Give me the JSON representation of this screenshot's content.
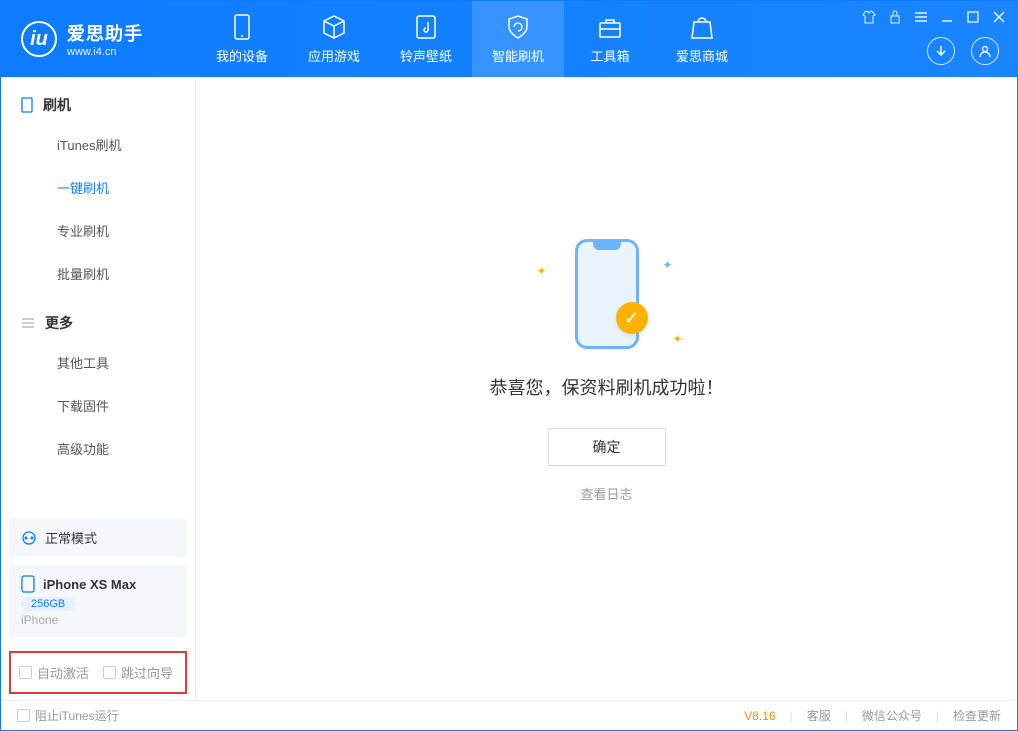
{
  "app": {
    "name": "爱思助手",
    "url": "www.i4.cn"
  },
  "nav": {
    "my_device": "我的设备",
    "apps_games": "应用游戏",
    "ringtones": "铃声壁纸",
    "smart_flash": "智能刷机",
    "toolbox": "工具箱",
    "store": "爱思商城"
  },
  "sidebar": {
    "section_flash": "刷机",
    "items_flash": [
      "iTunes刷机",
      "一键刷机",
      "专业刷机",
      "批量刷机"
    ],
    "section_more": "更多",
    "items_more": [
      "其他工具",
      "下载固件",
      "高级功能"
    ]
  },
  "device": {
    "mode": "正常模式",
    "name": "iPhone XS Max",
    "capacity": "256GB",
    "type": "iPhone"
  },
  "options": {
    "auto_activate": "自动激活",
    "skip_guide": "跳过向导"
  },
  "main": {
    "success_message": "恭喜您，保资料刷机成功啦！",
    "ok": "确定",
    "view_log": "查看日志"
  },
  "footer": {
    "block_itunes": "阻止iTunes运行",
    "version": "V8.16",
    "support": "客服",
    "wechat": "微信公众号",
    "check_update": "检查更新"
  }
}
